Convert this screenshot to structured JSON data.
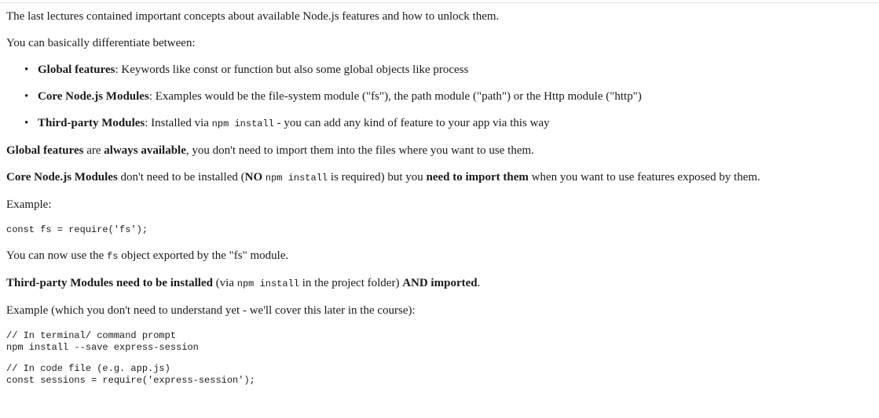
{
  "intro": "The last lectures contained important concepts about available Node.js features and how to unlock them.",
  "differentiate": "You can basically differentiate between:",
  "features": [
    {
      "term": "Global features",
      "desc": ": Keywords like const or function but also some global objects like process"
    },
    {
      "term": "Core Node.js Modules",
      "desc": ": Examples would be the file-system module (\"fs\"), the path module (\"path\") or the Http module (\"http\")"
    },
    {
      "term": "Third-party Modules",
      "desc_before": ": Installed via ",
      "code": "npm install",
      "desc_after": " - you can add any kind of feature to your app via this way"
    }
  ],
  "global_para": {
    "bold1": "Global features",
    "t1": " are ",
    "bold2": "always available",
    "t2": ", you don't need to import them into the files where you want to use them."
  },
  "core_para": {
    "bold1": "Core Node.js Modules",
    "t1": " don't need to be installed (",
    "bold2": "NO ",
    "code": "npm install",
    "t2": " is required) but you ",
    "bold3": "need to import them",
    "t3": " when you want to use features exposed by them."
  },
  "example_label": "Example:",
  "example_code": "const fs = require('fs');",
  "fs_para": {
    "t1": "You can now use the ",
    "code": "fs",
    "t2": " object exported by the \"fs\" module."
  },
  "third_para": {
    "bold1": "Third-party Modules need to be installed",
    "t1": " (via ",
    "code": "npm install",
    "t2": " in the project folder) ",
    "bold2": "AND imported",
    "t3": "."
  },
  "example2_label": "Example (which you don't need to understand yet - we'll cover this later in the course):",
  "code_block_1": "// In terminal/ command prompt\nnpm install --save express-session",
  "code_block_2": "// In code file (e.g. app.js)\nconst sessions = require('express-session');"
}
